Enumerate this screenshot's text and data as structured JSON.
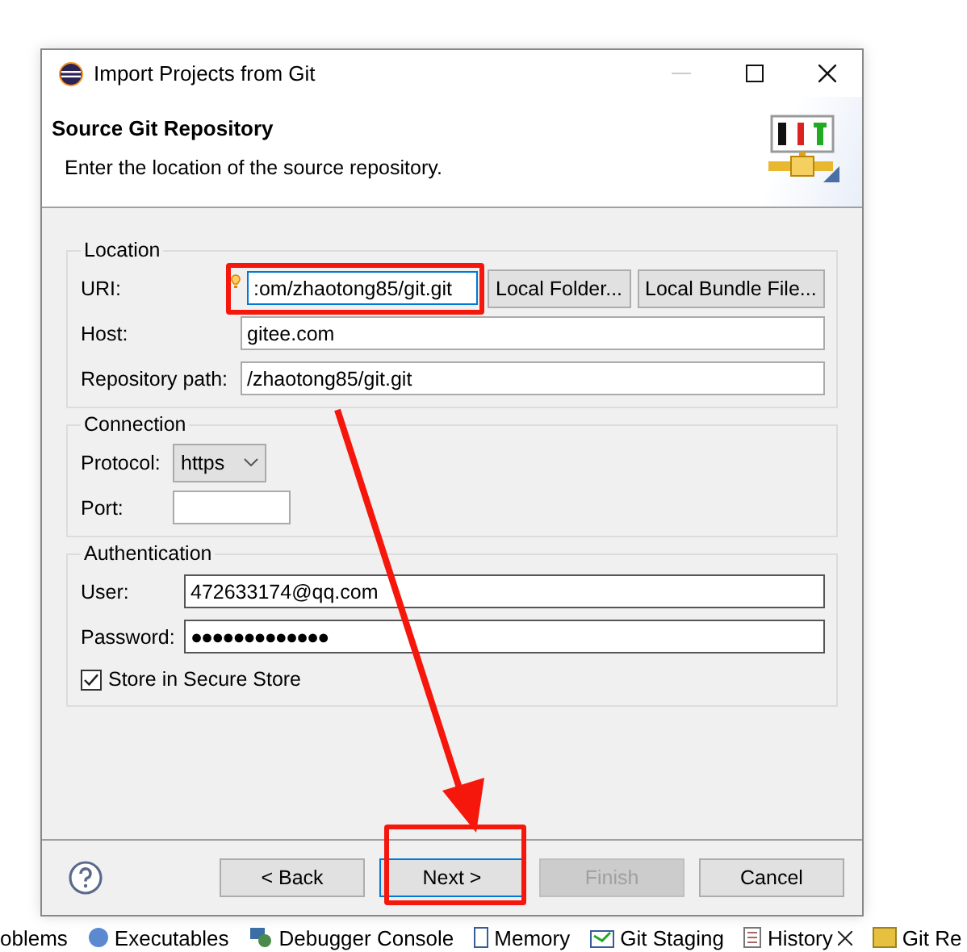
{
  "window": {
    "title": "Import Projects from Git"
  },
  "header": {
    "title": "Source Git Repository",
    "description": "Enter the location of the source repository."
  },
  "location": {
    "legend": "Location",
    "uri": {
      "label": "URI:",
      "value": ":om/zhaotong85/git.git",
      "focused": true
    },
    "buttons": [
      "Local Folder...",
      "Local Bundle File..."
    ],
    "host": {
      "label": "Host:",
      "value": "gitee.com"
    },
    "path": {
      "label": "Repository path:",
      "value": "/zhaotong85/git.git"
    }
  },
  "connection": {
    "legend": "Connection",
    "protocol": {
      "label": "Protocol:",
      "value": "https"
    },
    "port": {
      "label": "Port:"
    }
  },
  "authentication": {
    "legend": "Authentication",
    "user": {
      "label": "User:",
      "value": "472633174@qq.com"
    },
    "password": {
      "label": "Password:",
      "value": "●●●●●●●●●●●●●"
    },
    "store": {
      "label": "Store in Secure Store",
      "checked": true
    }
  },
  "buttons": [
    {
      "label": "< Back",
      "disabled": false,
      "default": false
    },
    {
      "label": "Next >",
      "disabled": false,
      "default": true
    },
    {
      "label": "Finish",
      "disabled": true,
      "default": false
    },
    {
      "label": "Cancel",
      "disabled": false,
      "default": false
    }
  ],
  "annotations": [
    {
      "kind": "frame"
    },
    {
      "kind": "arrow"
    },
    {
      "kind": "frame"
    }
  ],
  "views": [
    {
      "label": "oblems",
      "closable": false
    },
    {
      "label": "Executables",
      "closable": false
    },
    {
      "label": "Debugger Console",
      "closable": false
    },
    {
      "label": "Memory",
      "closable": false
    },
    {
      "label": "Git Staging",
      "closable": false
    },
    {
      "label": "History",
      "closable": true
    },
    {
      "label": "Git Re",
      "closable": false
    }
  ]
}
